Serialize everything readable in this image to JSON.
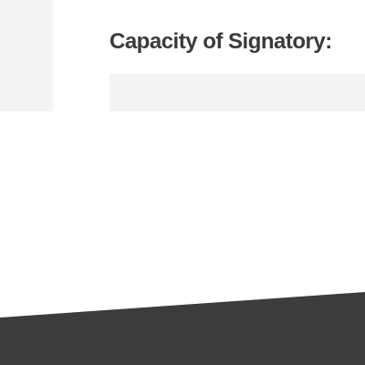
{
  "form": {
    "capacity_label": "Capacity of Signatory:",
    "capacity_value": ""
  },
  "colors": {
    "panel": "#f4f4f4",
    "label": "#3a3a3a",
    "footer": "#3c3c3c"
  }
}
